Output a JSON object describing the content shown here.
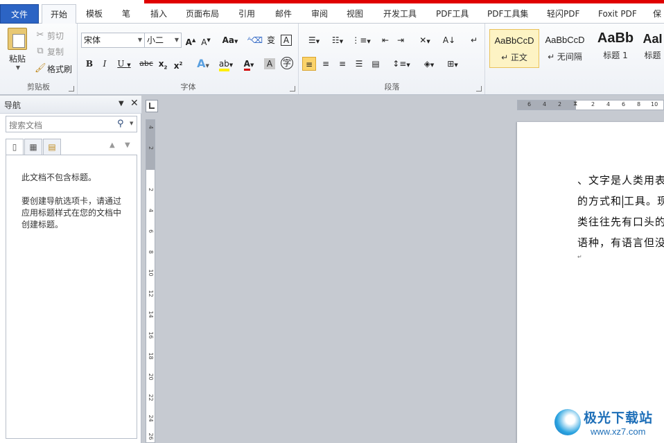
{
  "tabs": [
    {
      "label": "文件"
    },
    {
      "label": "开始"
    },
    {
      "label": "模板"
    },
    {
      "label": "笔"
    },
    {
      "label": "插入"
    },
    {
      "label": "页面布局"
    },
    {
      "label": "引用"
    },
    {
      "label": "邮件"
    },
    {
      "label": "审阅"
    },
    {
      "label": "视图"
    },
    {
      "label": "开发工具"
    },
    {
      "label": "PDF工具"
    },
    {
      "label": "PDF工具集"
    },
    {
      "label": "轻闪PDF"
    },
    {
      "label": "Foxit PDF"
    },
    {
      "label": "保"
    }
  ],
  "clipboard": {
    "paste": "粘贴",
    "cut": "剪切",
    "copy": "复制",
    "format_painter": "格式刷",
    "label": "剪贴板"
  },
  "font": {
    "name": "宋体",
    "size": "小二",
    "label": "字体"
  },
  "paragraph": {
    "label": "段落"
  },
  "styles": [
    {
      "sample": "AaBbCcD",
      "name": "↵ 正文"
    },
    {
      "sample": "AaBbCcD",
      "name": "↵ 无间隔"
    },
    {
      "sample": "AaBb",
      "name": "标题 1"
    },
    {
      "sample": "AaI",
      "name": "标题"
    }
  ],
  "nav": {
    "title": "导航",
    "search_placeholder": "搜索文档",
    "msg1": "此文档不包含标题。",
    "msg2": "要创建导航选项卡，请通过应用标题样式在您的文档中创建标题。"
  },
  "ruler": {
    "h_ticks": [
      "6",
      "4",
      "2",
      "2",
      "4",
      "6",
      "8",
      "10"
    ],
    "v_ticks": [
      "4",
      "2",
      "2",
      "4",
      "6",
      "8",
      "10",
      "12",
      "14",
      "16",
      "18",
      "20",
      "22",
      "24",
      "26"
    ]
  },
  "document": {
    "line1": "、文字是人类用表",
    "line2a": "的方式和",
    "line2b": "工具。现",
    "line3": "类往往先有口头的",
    "line4": "语种，有语言但没",
    "para_mark": "↵"
  },
  "watermark": {
    "title": "极光下载站",
    "url": "www.xz7.com"
  }
}
